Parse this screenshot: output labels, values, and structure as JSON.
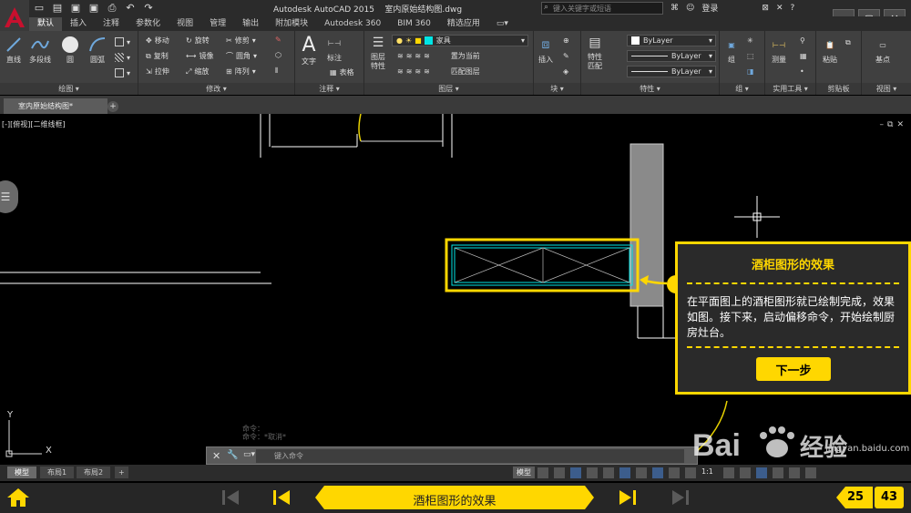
{
  "window": {
    "app_title": "Autodesk AutoCAD 2015",
    "file_name": "室内原始结构图.dwg",
    "search_placeholder": "键入关键字或短语",
    "login_label": "登录"
  },
  "ribbon_tabs": [
    "默认",
    "插入",
    "注释",
    "参数化",
    "视图",
    "管理",
    "输出",
    "附加模块",
    "Autodesk 360",
    "BIM 360",
    "精选应用"
  ],
  "ribbon": {
    "draw": {
      "title": "绘图",
      "tools": [
        "直线",
        "多段线",
        "圆",
        "圆弧"
      ]
    },
    "modify": {
      "title": "修改",
      "tools": [
        "移动",
        "旋转",
        "修剪",
        "复制",
        "镜像",
        "圆角",
        "拉伸",
        "缩放",
        "阵列"
      ]
    },
    "annotation": {
      "title": "注释",
      "tools": [
        "文字",
        "标注",
        "表格"
      ]
    },
    "layers": {
      "title": "图层",
      "properties_label": "图层特性",
      "current_layer": "家具",
      "set_current": "置为当前",
      "match_layer": "匹配图层"
    },
    "block": {
      "title": "块",
      "insert_label": "插入"
    },
    "properties": {
      "title": "特性",
      "match_label": "特性匹配",
      "color": "ByLayer",
      "linetype": "ByLayer",
      "lineweight": "ByLayer"
    },
    "groups": {
      "title": "组",
      "group_label": "组"
    },
    "utilities": {
      "title": "实用工具",
      "measure_label": "测量"
    },
    "clipboard": {
      "title": "剪贴板",
      "paste_label": "粘贴"
    },
    "view": {
      "title": "视图",
      "base_label": "基点"
    }
  },
  "doc_tab": {
    "label": "室内原始结构图*"
  },
  "viewport_label": "[-][俯视][二维线框]",
  "card": {
    "title": "酒柜图形的效果",
    "body": "在平面图上的酒柜图形就已绘制完成，效果如图。接下来，启动偏移命令，开始绘制厨房灶台。",
    "next_label": "下一步"
  },
  "command": {
    "placeholder": "键入命令",
    "history": [
      "命令：",
      "命令：*取消*"
    ]
  },
  "layout_tabs": [
    "模型",
    "布局1",
    "布局2"
  ],
  "status": {
    "model_label": "模型",
    "scale_label": "1:1"
  },
  "nav": {
    "step_title": "酒柜图形的效果",
    "current_page": "25",
    "total_pages": "43"
  },
  "watermark": {
    "brand": "Baidu经验",
    "url": "jingyan.baidu.com"
  },
  "colors": {
    "accent": "#ffd700",
    "autocad_red": "#c8102e",
    "layer_cyan": "#00e5e5"
  }
}
